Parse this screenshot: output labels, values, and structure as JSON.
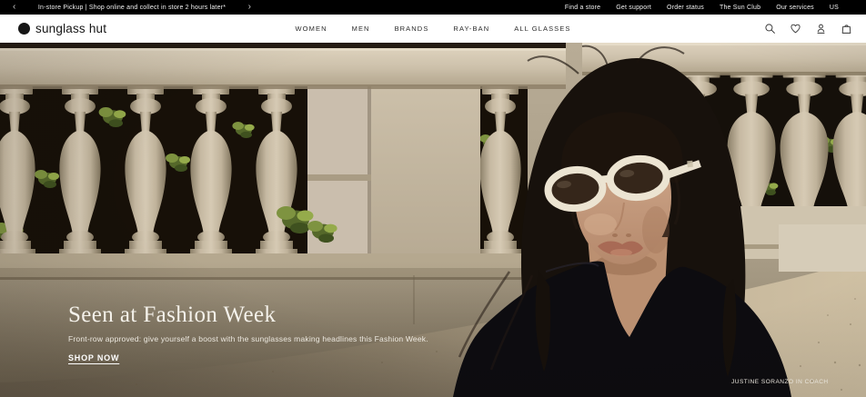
{
  "promo_bar": {
    "prev_icon": "‹",
    "next_icon": "›",
    "message": "In-store Pickup | Shop online and collect in store 2 hours later*",
    "links": [
      "Find a store",
      "Get support",
      "Order status",
      "The Sun Club",
      "Our services",
      "US"
    ]
  },
  "nav": {
    "logo_text": "sunglass hut",
    "items": [
      "WOMEN",
      "MEN",
      "BRANDS",
      "RAY-BAN",
      "ALL GLASSES"
    ],
    "icons": [
      "search-icon",
      "wishlist-icon",
      "account-icon",
      "shopping-bag-icon"
    ]
  },
  "hero": {
    "title": "Seen at Fashion Week",
    "subtitle": "Front-row approved: give yourself a boost with the sunglasses making headlines this Fashion Week.",
    "cta_label": "SHOP NOW",
    "credit": "JUSTINE SORANZO IN COACH"
  },
  "colors": {
    "promo_bar_bg": "#000000",
    "nav_bg": "#ffffff",
    "nav_text": "#2b2b2b",
    "hero_text": "#f4f1ea",
    "stone_light": "#d2c6b0",
    "stone_dark": "#988c74",
    "ivy_green": "#7e9340",
    "hair_black": "#17110c",
    "garment_black": "#0d0c10",
    "sunglasses_frame": "#ece4d2"
  }
}
